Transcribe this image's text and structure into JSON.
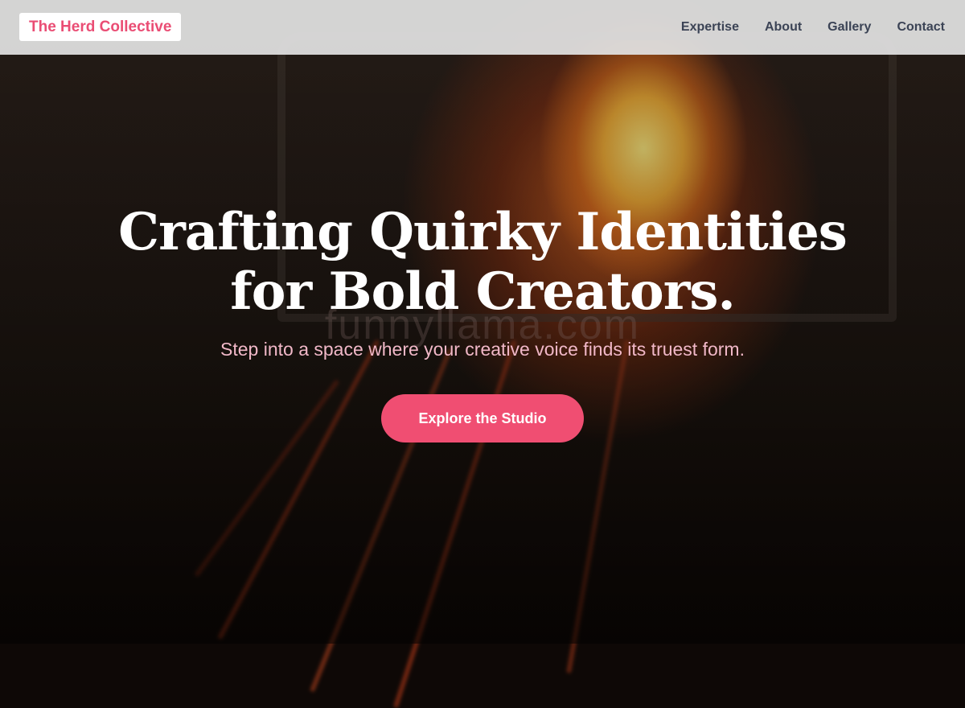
{
  "header": {
    "logo": "The Herd Collective",
    "nav": [
      {
        "label": "Expertise"
      },
      {
        "label": "About"
      },
      {
        "label": "Gallery"
      },
      {
        "label": "Contact"
      }
    ]
  },
  "hero": {
    "headline_line1": "Crafting Quirky Identities",
    "headline_line2": "for Bold Creators.",
    "watermark": "funnyllama.com",
    "subtext": "Step into a space where your creative voice finds its truest form.",
    "cta_label": "Explore the Studio"
  },
  "colors": {
    "accent": "#f04e72",
    "logo_text": "#ea4d74",
    "nav_text": "#3b4355",
    "subtext": "#f1b8c8"
  }
}
